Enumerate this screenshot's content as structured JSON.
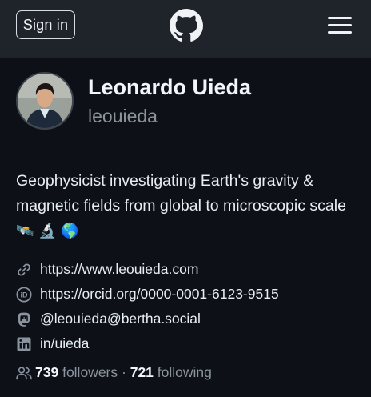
{
  "header": {
    "signin_label": "Sign in",
    "logo_icon": "github-logo-icon",
    "menu_icon": "hamburger-menu-icon"
  },
  "profile": {
    "name": "Leonardo Uieda",
    "login": "leouieda",
    "bio": "Geophysicist investigating Earth's gravity & magnetic fields from global to microscopic scale",
    "bio_emojis": "🛰️ 🔬 🌎"
  },
  "links": [
    {
      "icon": "link-icon",
      "text": "https://www.leouieda.com"
    },
    {
      "icon": "orcid-icon",
      "text": "https://orcid.org/0000-0001-6123-9515"
    },
    {
      "icon": "mastodon-icon",
      "text": "@leouieda@bertha.social"
    },
    {
      "icon": "linkedin-icon",
      "text": "in/uieda"
    }
  ],
  "stats": {
    "followers_count": "739",
    "followers_label": "followers",
    "separator": "·",
    "following_count": "721",
    "following_label": "following"
  }
}
